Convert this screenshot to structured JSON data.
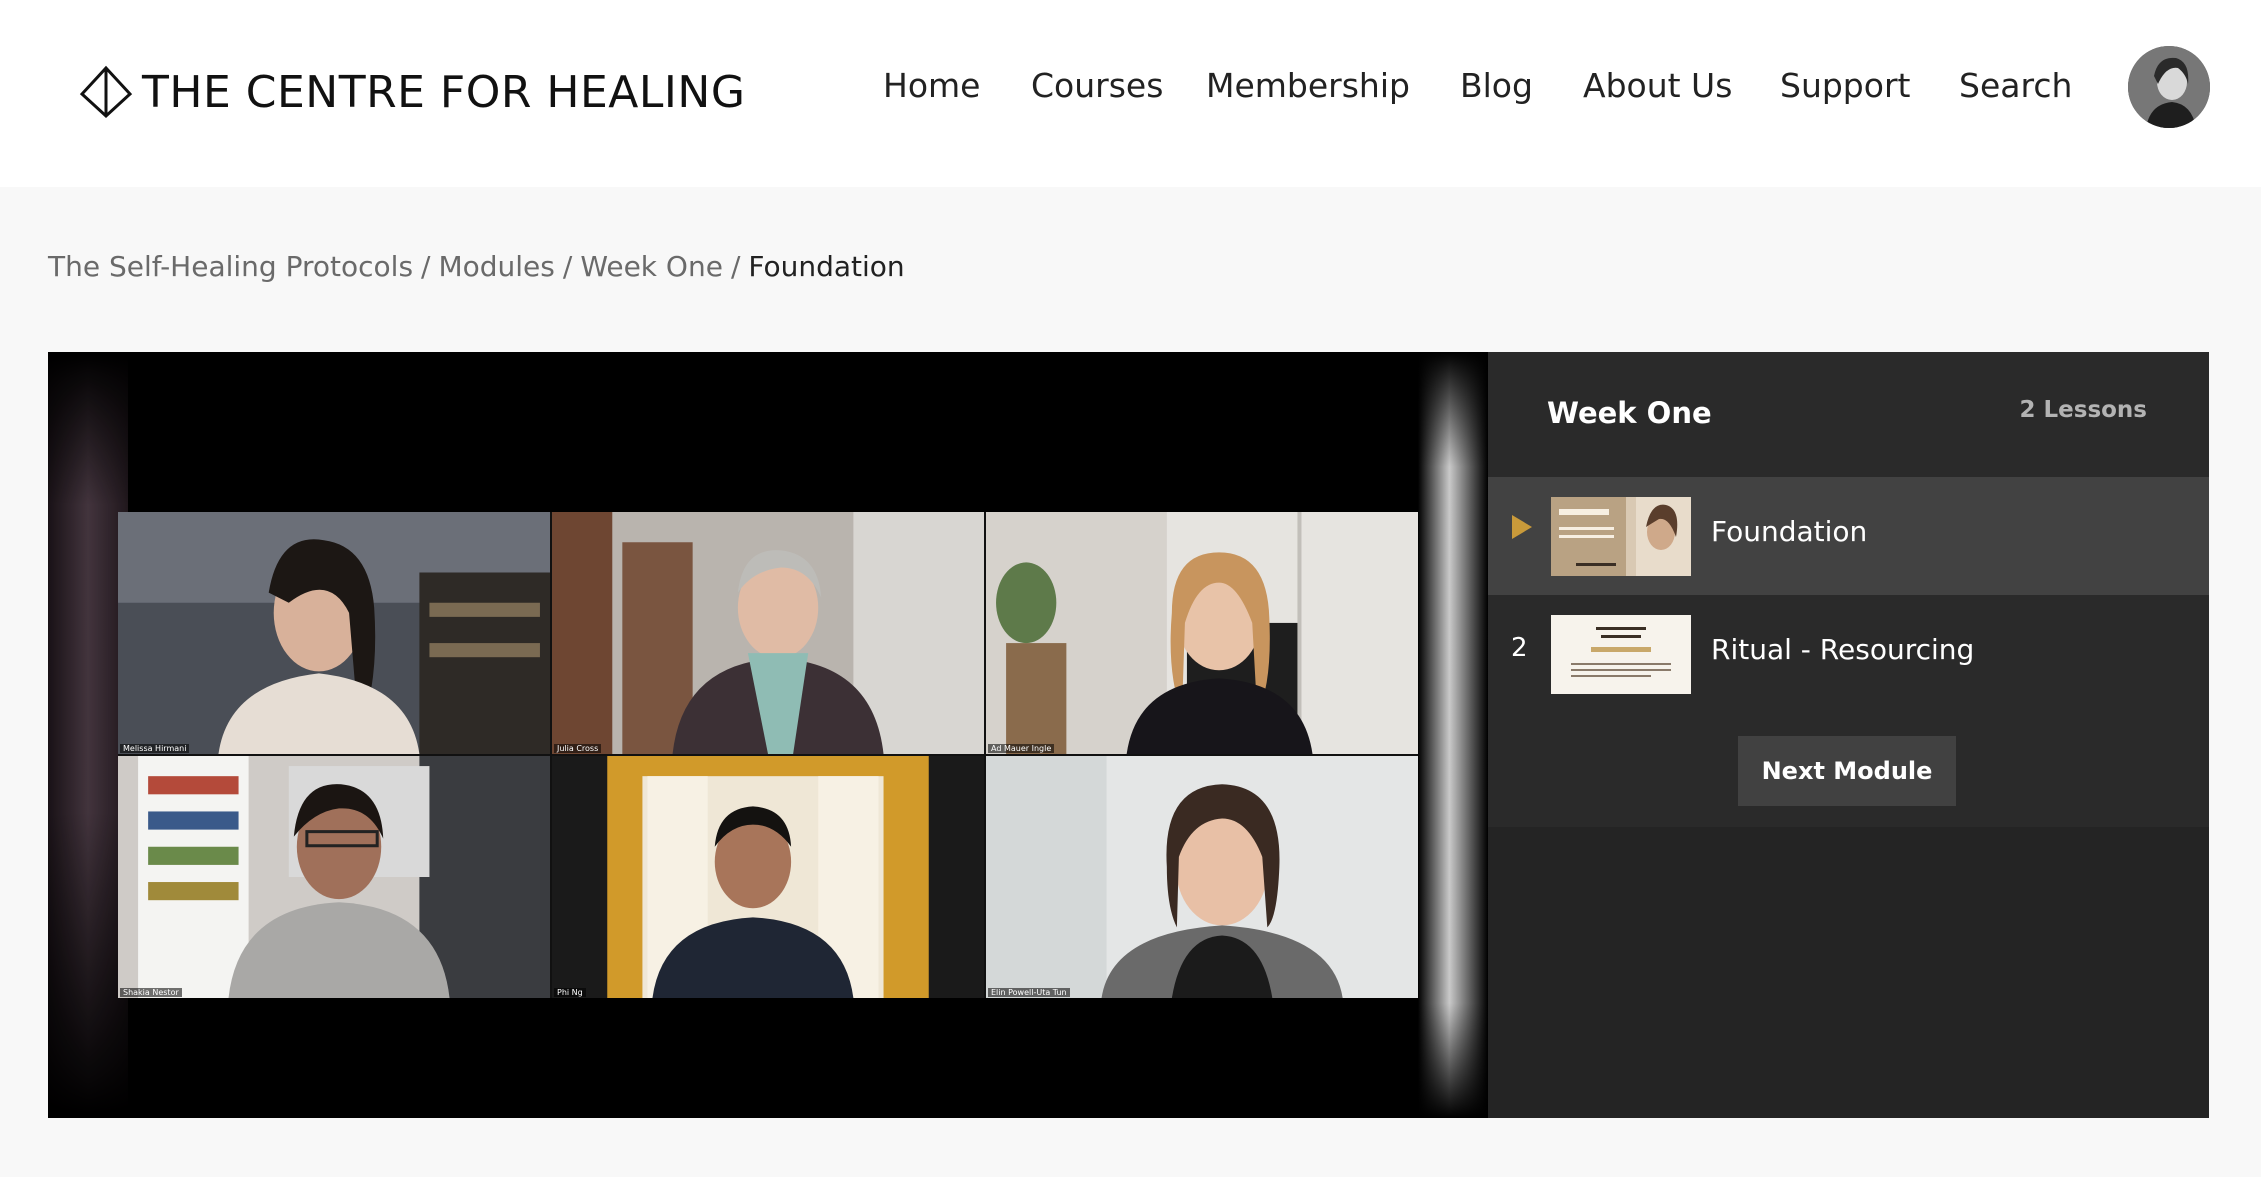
{
  "header": {
    "logo_text": "THE CENTRE FOR HEALING",
    "nav": [
      "Home",
      "Courses",
      "Membership",
      "Blog",
      "About Us",
      "Support",
      "Search"
    ]
  },
  "breadcrumb": {
    "items": [
      "The Self-Healing Protocols",
      "Modules",
      "Week One"
    ],
    "current": "Foundation",
    "separator": "/"
  },
  "sidebar": {
    "title": "Week One",
    "lesson_count": "2 Lessons",
    "lessons": [
      {
        "marker": "play-icon",
        "title": "Foundation",
        "active": true
      },
      {
        "marker": "2",
        "title": "Ritual - Resourcing",
        "active": false
      }
    ],
    "next_button": "Next Module"
  },
  "video": {
    "participants": [
      "Melissa Hirmani",
      "Julia Cross",
      "Ad Mauer Ingle",
      "Shakia Nestor",
      "Phi Ng",
      "Elin Powell-Uta Tun"
    ]
  },
  "colors": {
    "accent": "#c99a3a",
    "sidebar_bg": "#2a2a2a",
    "active_row_bg": "#424242"
  }
}
